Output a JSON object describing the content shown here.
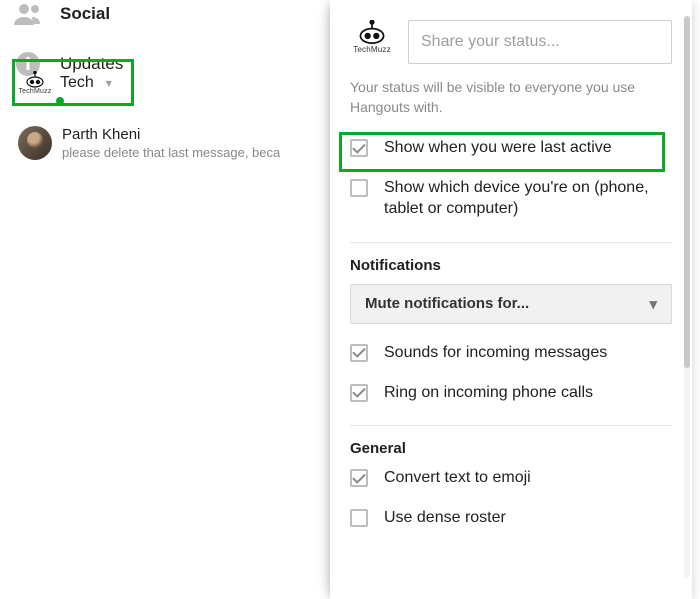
{
  "brand": {
    "name": "TechMuzz"
  },
  "left": {
    "social_label": "Social",
    "updates_label": "Updates",
    "account_label": "Tech",
    "conv": {
      "name": "Parth Kheni",
      "preview": "please delete that last message, beca"
    }
  },
  "panel": {
    "status_placeholder": "Share your status...",
    "status_hint": "Your status will be visible to everyone you use Hangouts with.",
    "opts": {
      "last_active": "Show when you were last active",
      "device": "Show which device you're on (phone, tablet or computer)"
    },
    "notifications": {
      "heading": "Notifications",
      "mute_label": "Mute notifications for...",
      "sounds": "Sounds for incoming messages",
      "ring": "Ring on incoming phone calls"
    },
    "general": {
      "heading": "General",
      "emoji": "Convert text to emoji",
      "dense": "Use dense roster"
    }
  }
}
